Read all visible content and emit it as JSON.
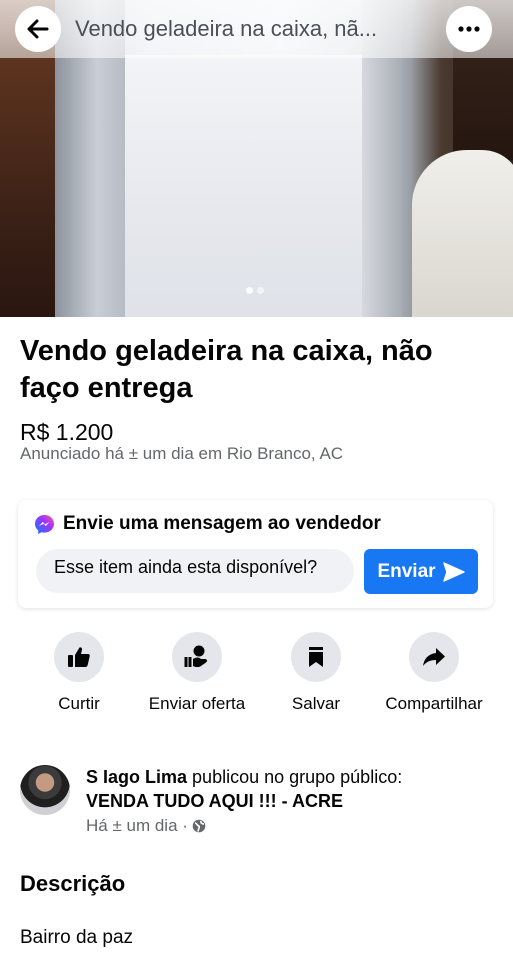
{
  "header": {
    "title": "Vendo geladeira na caixa, nã..."
  },
  "gallery": {
    "page_count": 2,
    "active_index": 0
  },
  "listing": {
    "title": "Vendo geladeira na caixa, não faço entrega",
    "price": "R$ 1.200",
    "posted": "Anunciado há ± um dia em Rio Branco, AC"
  },
  "message": {
    "heading": "Envie uma mensagem ao vendedor",
    "input_value": "Esse item ainda esta disponível?",
    "send_label": "Enviar"
  },
  "actions": [
    {
      "label": "Curtir",
      "icon": "thumbs-up-icon"
    },
    {
      "label": "Enviar oferta",
      "icon": "offer-icon"
    },
    {
      "label": "Salvar",
      "icon": "bookmark-icon"
    },
    {
      "label": "Compartilhar",
      "icon": "share-icon"
    }
  ],
  "poster": {
    "name": "S Iago Lima",
    "published_text": "publicou no grupo público:",
    "group": "VENDA TUDO AQUI !!! - ACRE",
    "time": "Há ± um dia ·",
    "visibility_icon": "globe-icon"
  },
  "description": {
    "heading": "Descrição",
    "text": "Bairro da paz"
  },
  "colors": {
    "accent": "#1877f2",
    "secondary_text": "#65676b",
    "icon_bg": "#e4e6eb"
  }
}
